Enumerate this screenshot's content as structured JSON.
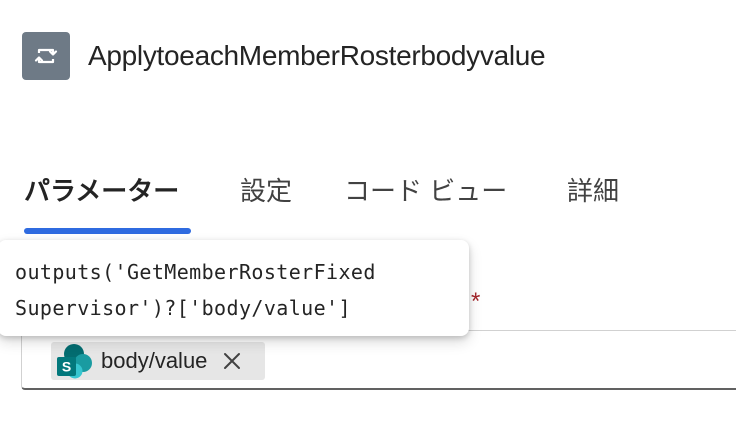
{
  "header": {
    "icon": "loop-icon",
    "icon_bg": "#6e7a86",
    "title": "ApplytoeachMemberRosterbodyvalue"
  },
  "tabs": [
    {
      "label": "パラメーター",
      "active": true
    },
    {
      "label": "設定",
      "active": false
    },
    {
      "label": "コード ビュー",
      "active": false
    },
    {
      "label": "詳細",
      "active": false
    }
  ],
  "accent_color": "#2f6be0",
  "field": {
    "required_marker": "*",
    "token": {
      "icon": "sharepoint-icon",
      "label": "body/value",
      "remove_icon": "close-icon"
    }
  },
  "tooltip": {
    "lines": [
      "outputs('GetMemberRosterFixed",
      "Supervisor')?['body/value']"
    ]
  }
}
